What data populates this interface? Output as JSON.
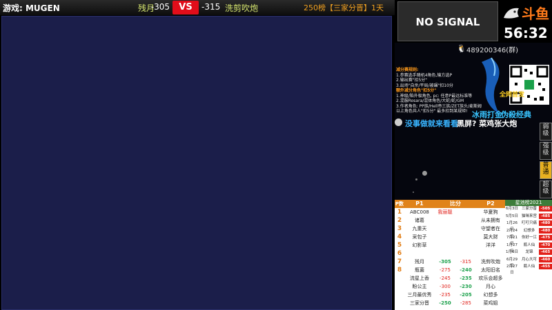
{
  "topbar": {
    "game_title": "游戏: MUGEN",
    "p1_name": "残月",
    "p1_score": "-305",
    "vs": "VS",
    "p2_score": "-315",
    "p2_name": "洗剪吹炮",
    "rank": "250榜【三家分晋】1天"
  },
  "stream": {
    "no_signal": "NO SIGNAL",
    "brand": "斗鱼",
    "timer": "56:32",
    "qq_group": "489200346(群)",
    "rules_title": "减分赛规则:",
    "rules": [
      "1.参赛选手随机4角色,输方选P",
      "2.输出赛\"扣5分\"",
      "3.出场\"自杀/平局/被碾\"扣10分",
      "额外减分角色\"扣5分\"",
      "1.神级/陷外极角色, pc: 任意P最远标准等",
      "2.混服Rosara/混体角色/大蛇/蛇/GM",
      "3.作者角色: PP族/Hell帝三族/ZET族头/麦斯姆",
      "以上角色共人\"扣5分\" 最多扣到某规矩!"
    ],
    "slogan_a": "全网首发",
    "slogan_b": "冰雨打金",
    "slogan_c": "伪殺经典",
    "chat_1": "没事做就来看看",
    "chat_2": "黑屏? 菜鸡张大炮"
  },
  "side_buttons": [
    "弱级",
    "强级",
    "普通",
    "超级"
  ],
  "table": {
    "headers": {
      "pnum": "P数",
      "p1": "P1",
      "diff": "比分",
      "p2": "P2"
    },
    "rows": [
      {
        "num": "1",
        "a": "ABC008",
        "b": "我丽靓",
        "c": "",
        "d": "华夏狗"
      },
      {
        "num": "2",
        "a": "诸葛",
        "b": "",
        "c": "",
        "d": "从未拥有"
      },
      {
        "num": "3",
        "a": "九重天",
        "b": "",
        "c": "",
        "d": "守望者在"
      },
      {
        "num": "4",
        "a": "采包子",
        "b": "",
        "c": "",
        "d": "莫大财"
      },
      {
        "num": "5",
        "a": "幻影草",
        "b": "",
        "c": "",
        "d": "洋洋"
      },
      {
        "num": "6",
        "a": "",
        "b": "",
        "c": "",
        "d": ""
      },
      {
        "num": "7",
        "a": "残月",
        "b": "-305",
        "c": "-315",
        "d": "洗剪吹炮"
      },
      {
        "num": "8",
        "a": "瓶菌",
        "b": "-275",
        "c": "-240",
        "d": "太阳旧名"
      },
      {
        "num": "",
        "a": "流星上香",
        "b": "-245",
        "c": "-235",
        "d": "欢乐会超多"
      },
      {
        "num": "",
        "a": "盼公主",
        "b": "-300",
        "c": "-230",
        "d": "月心"
      },
      {
        "num": "",
        "a": "三月最优秀",
        "b": "-235",
        "c": "-205",
        "d": "幻想多"
      },
      {
        "num": "",
        "a": "三家分晋",
        "b": "-250",
        "c": "-285",
        "d": "菜鸡姐"
      }
    ]
  },
  "history": {
    "title": "星池榜2021",
    "rows": [
      {
        "date": "6月3日",
        "name": "三家分晋",
        "score": "-505"
      },
      {
        "date": "5月5日",
        "name": "猫咪来宫",
        "score": "-485"
      },
      {
        "date": "1月26日",
        "name": "叮叮只痛",
        "score": "-480"
      },
      {
        "date": "2月24日",
        "name": "幻想多",
        "score": "-480"
      },
      {
        "date": "7月21日",
        "name": "你好一江",
        "score": "-475"
      },
      {
        "date": "1月27日",
        "name": "瓶人仙",
        "score": "-470"
      },
      {
        "date": "1月6日",
        "name": "龙锦",
        "score": "-465"
      },
      {
        "date": "6月29日",
        "name": "月心大可",
        "score": "-460"
      },
      {
        "date": "2月27日",
        "name": "瓶人仙",
        "score": "-455"
      }
    ]
  }
}
